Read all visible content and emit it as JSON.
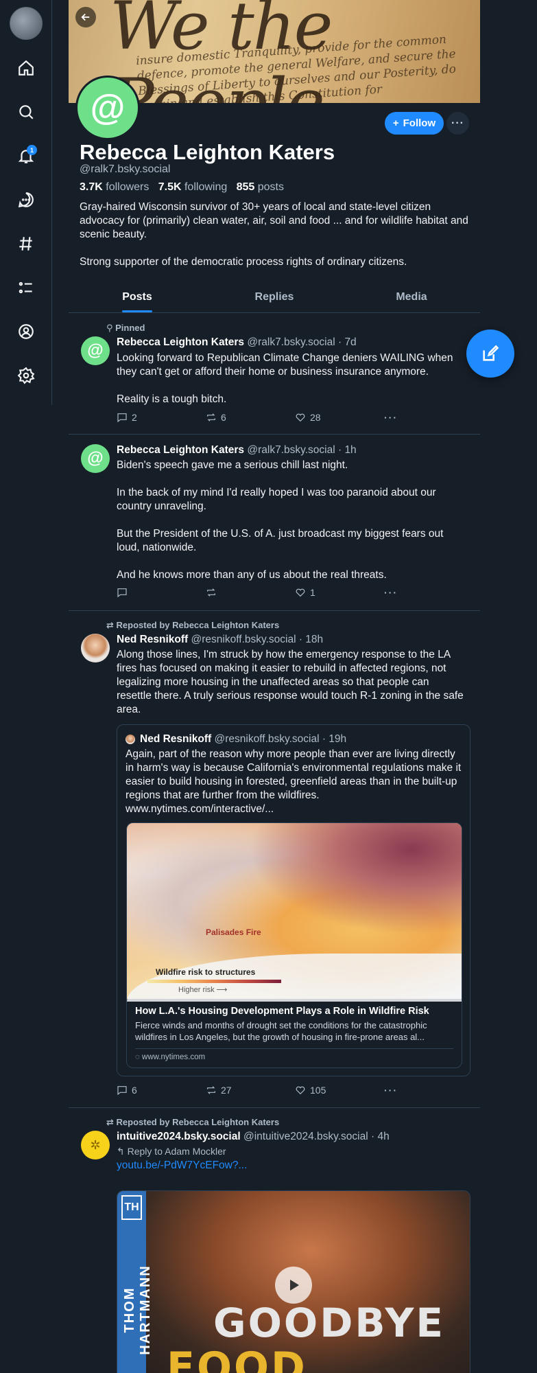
{
  "nav": {
    "notification_count": "1",
    "items": [
      "home-icon",
      "search-icon",
      "bell-icon",
      "chat-icon",
      "hashtag-icon",
      "list-icon",
      "profile-icon",
      "settings-icon"
    ]
  },
  "profile": {
    "avatar_glyph": "@",
    "display_name": "Rebecca Leighton Katers",
    "handle": "@ralk7.bsky.social",
    "followers_count": "3.7K",
    "followers_label": "followers",
    "following_count": "7.5K",
    "following_label": "following",
    "posts_count": "855",
    "posts_label": "posts",
    "bio": "Gray-haired Wisconsin survivor of 30+ years of local and state-level citizen advocacy for (primarily) clean water, air, soil and food ... and for wildlife habitat and scenic beauty.\n\nStrong supporter of the democratic process rights of ordinary citizens.",
    "follow_label": "Follow",
    "more_label": "···"
  },
  "banner": {
    "script": "We the People",
    "lines": "insure domestic Tranquility, provide for the common defence, promote the general Welfare, and secure the Blessings of Liberty to ourselves and our Posterity, do ordain and establish this Constitution for"
  },
  "tabs": [
    "Posts",
    "Replies",
    "Media"
  ],
  "posts": [
    {
      "pinned_label": "Pinned",
      "author": "Rebecca Leighton Katers",
      "meta": "@ralk7.bsky.social · 7d",
      "text": "Looking forward to Republican Climate Change deniers WAILING when they can't get or afford their home or business insurance anymore.\n\nReality is a tough bitch.",
      "replies": "2",
      "reposts": "6",
      "likes": "28"
    },
    {
      "author": "Rebecca Leighton Katers",
      "meta": "@ralk7.bsky.social · 1h",
      "text": "Biden's speech gave me a serious chill last night.\n\nIn the back of my mind I'd really hoped I was too paranoid about our country unraveling.\n\nBut the President of the U.S. of A. just broadcast my biggest fears out loud, nationwide.\n\nAnd he knows more than any of us about the real threats.",
      "replies": "",
      "reposts": "",
      "likes": "1"
    },
    {
      "repost_label": "Reposted by Rebecca Leighton Katers",
      "author": "Ned Resnikoff",
      "meta": "@resnikoff.bsky.social · 18h",
      "text": "Along those lines, I'm struck by how the emergency response to the LA fires has focused on making it easier to rebuild in affected regions, not legalizing more housing in the unaffected areas so that people can resettle there. A truly serious response would touch R-1 zoning in the safe area.",
      "quote": {
        "author": "Ned Resnikoff",
        "meta": "@resnikoff.bsky.social · 19h",
        "text": "Again, part of the reason why more people than ever are living directly in harm's way is because California's environmental regulations make it easier to build housing in forested, greenfield areas than in the built-up regions that are further from the wildfires. www.nytimes.com/interactive/...",
        "card": {
          "fire_label": "Palisades Fire",
          "legend_title": "Wildfire risk to structures",
          "legend_sub": "Higher risk ⟶",
          "title": "How L.A.'s Housing Development Plays a Role in Wildfire Risk",
          "description": "Fierce winds and months of drought set the conditions for the catastrophic wildfires in Los Angeles, but the growth of housing in fire-prone areas al...",
          "domain": "www.nytimes.com"
        }
      },
      "replies": "6",
      "reposts": "27",
      "likes": "105"
    },
    {
      "repost_label": "Reposted by Rebecca Leighton Katers",
      "author": "intuitive2024.bsky.social",
      "meta": "@intuitive2024.bsky.social · 4h",
      "reply_to": "Reply to Adam Mockler",
      "link": "youtu.be/-PdW7YcEFow?...",
      "video": {
        "side_text": "THOM HARTMANN",
        "logo": "TH",
        "line1": "GOODBYE",
        "line2": "FOOD STAMPS"
      }
    }
  ],
  "colors": {
    "accent": "#208bfe",
    "background": "#161e27",
    "border": "#2e4052",
    "muted": "#aebbc9"
  }
}
